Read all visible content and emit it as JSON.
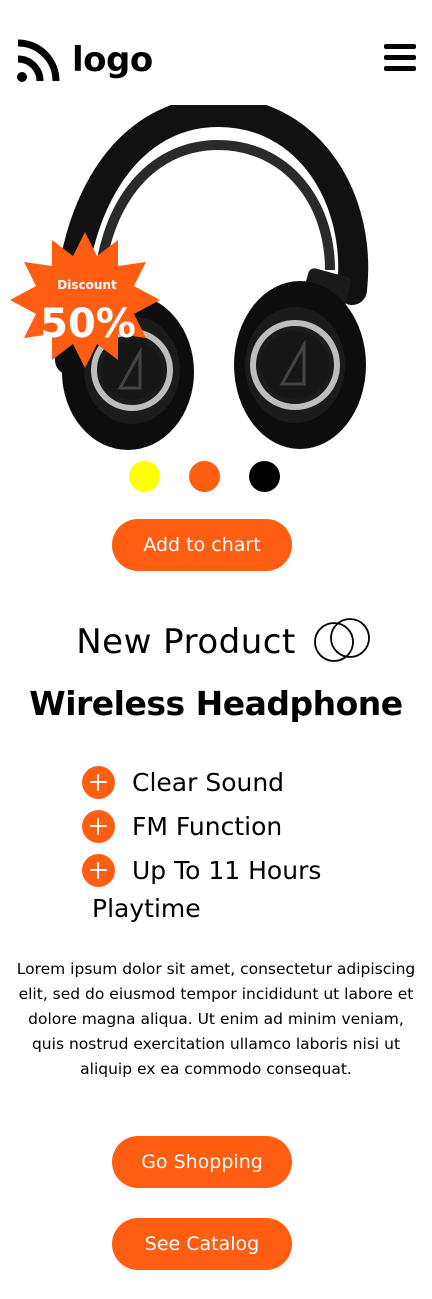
{
  "header": {
    "logo_text": "logo",
    "logo_icon": "rss-icon",
    "menu_icon": "hamburger-menu-icon"
  },
  "product": {
    "badge_label": "Discount",
    "badge_value": "50%",
    "image": "over-ear-headphones"
  },
  "swatches": [
    {
      "name": "yellow",
      "color": "#ffff00"
    },
    {
      "name": "orange",
      "color": "#ff5e12"
    },
    {
      "name": "black",
      "color": "#000000"
    }
  ],
  "actions": {
    "add_to_cart": "Add to chart",
    "go_shopping": "Go Shopping",
    "see_catalog": "See Catalog"
  },
  "section": {
    "new_product": "New Product",
    "title": "Wireless Headphone"
  },
  "features": [
    "Clear Sound",
    "FM Function",
    "Up To 11 Hours"
  ],
  "feature_wrap": "Playtime",
  "description": "Lorem ipsum dolor sit amet, consectetur adipiscing elit, sed do eiusmod tempor incididunt ut labore et dolore magna aliqua. Ut enim ad minim veniam, quis nostrud exercitation ullamco laboris nisi ut aliquip ex ea commodo consequat.",
  "colors": {
    "accent": "#ff5e12",
    "text": "#000000",
    "background": "#ffffff"
  }
}
